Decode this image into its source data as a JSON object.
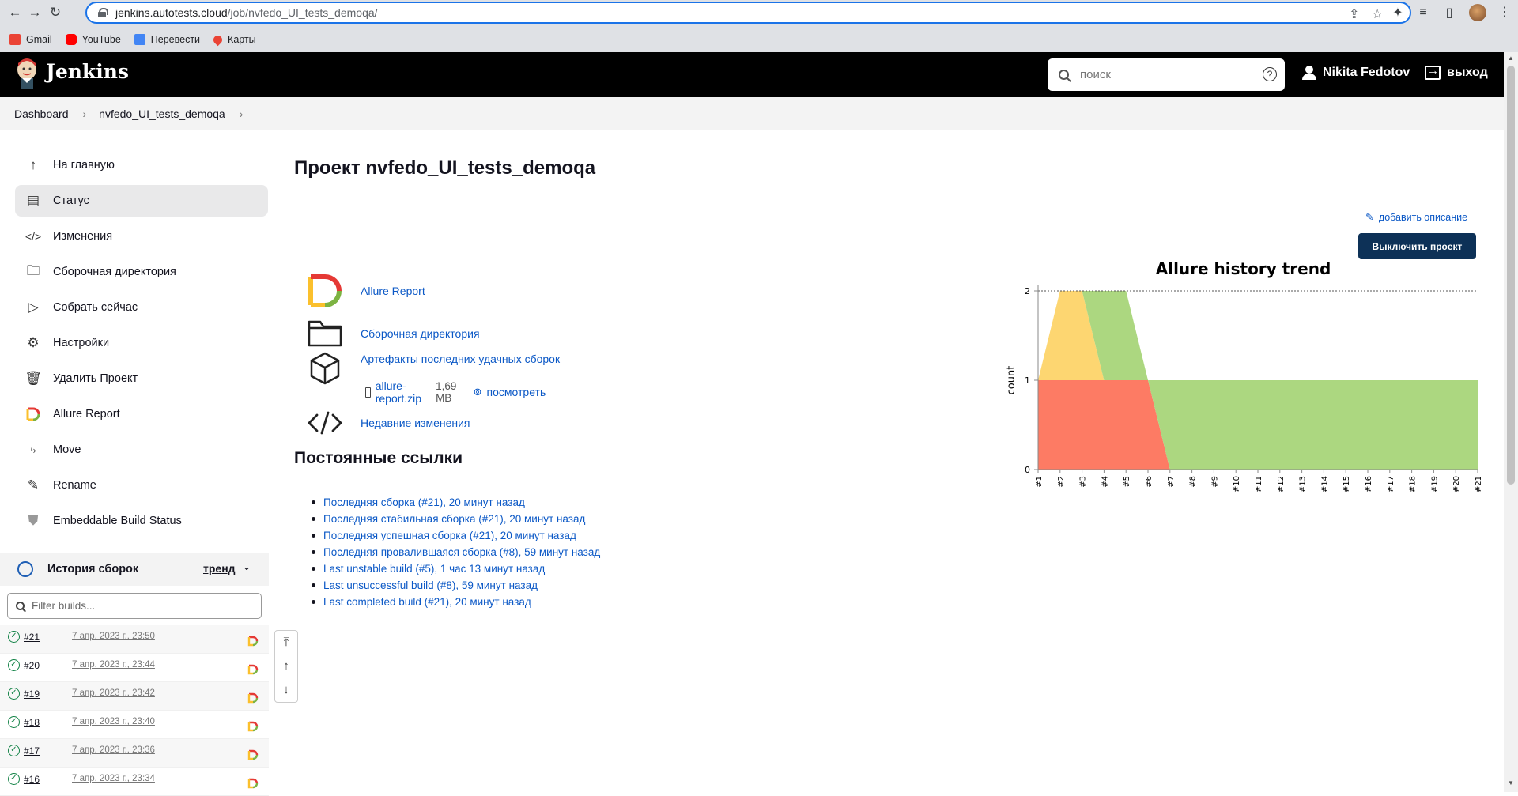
{
  "browser": {
    "url_host": "jenkins.autotests.cloud",
    "url_path": "/job/nvfedo_UI_tests_demoqa/",
    "bookmarks": [
      {
        "label": "Gmail",
        "color": "#ea4335"
      },
      {
        "label": "YouTube",
        "color": "#ff0000"
      },
      {
        "label": "Перевести",
        "color": "#4285f4"
      },
      {
        "label": "Карты",
        "color": "#ea4335"
      }
    ]
  },
  "header": {
    "title": "Jenkins",
    "search_placeholder": "поиск",
    "help": "?",
    "user": "Nikita Fedotov",
    "logout": "выход"
  },
  "breadcrumb": {
    "items": [
      "Dashboard",
      "nvfedo_UI_tests_demoqa"
    ]
  },
  "sidebar": {
    "items": [
      {
        "label": "На главную",
        "icon": "arrow-up-icon"
      },
      {
        "label": "Статус",
        "icon": "status-icon",
        "active": true
      },
      {
        "label": "Изменения",
        "icon": "code-icon"
      },
      {
        "label": "Сборочная директория",
        "icon": "folder-icon"
      },
      {
        "label": "Собрать сейчас",
        "icon": "play-icon"
      },
      {
        "label": "Настройки",
        "icon": "gear-icon"
      },
      {
        "label": "Удалить Проект",
        "icon": "trash-icon"
      },
      {
        "label": "Allure Report",
        "icon": "allure-icon"
      },
      {
        "label": "Move",
        "icon": "move-icon"
      },
      {
        "label": "Rename",
        "icon": "pencil-icon"
      },
      {
        "label": "Embeddable Build Status",
        "icon": "shield-icon"
      }
    ]
  },
  "history": {
    "title": "История сборок",
    "trend": "тренд",
    "filter_placeholder": "Filter builds...",
    "builds": [
      {
        "num": "#21",
        "date": "7 апр. 2023 г., 23:50"
      },
      {
        "num": "#20",
        "date": "7 апр. 2023 г., 23:44"
      },
      {
        "num": "#19",
        "date": "7 апр. 2023 г., 23:42"
      },
      {
        "num": "#18",
        "date": "7 апр. 2023 г., 23:40"
      },
      {
        "num": "#17",
        "date": "7 апр. 2023 г., 23:36"
      },
      {
        "num": "#16",
        "date": "7 апр. 2023 г., 23:34"
      }
    ]
  },
  "main": {
    "title": "Проект nvfedo_UI_tests_demoqa",
    "add_description": "добавить описание",
    "disable_button": "Выключить проект",
    "links": {
      "allure": "Allure Report",
      "workspace": "Сборочная директория",
      "artifacts": "Артефакты последних удачных сборок",
      "artifact_file": "allure-report.zip",
      "artifact_size": "1,69 MB",
      "artifact_view": "посмотреть",
      "changes": "Недавние изменения"
    },
    "permalinks_title": "Постоянные ссылки",
    "permalinks": [
      "Последняя сборка (#21), 20 минут назад",
      "Последняя стабильная сборка (#21), 20 минут назад",
      "Последняя успешная сборка (#21), 20 минут назад",
      "Последняя провалившаяся сборка (#8), 59 минут назад",
      "Last unstable build (#5), 1 час 13 минут назад",
      "Last unsuccessful build (#8), 59 минут назад",
      "Last completed build (#21), 20 минут назад"
    ]
  },
  "chart_data": {
    "type": "area",
    "title": "Allure history trend",
    "ylabel": "count",
    "xlabel": "",
    "ylim": [
      0,
      2
    ],
    "yticks": [
      "0",
      "1",
      "2"
    ],
    "categories": [
      "#1",
      "#2",
      "#3",
      "#4",
      "#5",
      "#6",
      "#7",
      "#8",
      "#9",
      "#10",
      "#11",
      "#12",
      "#13",
      "#14",
      "#15",
      "#16",
      "#17",
      "#18",
      "#19",
      "#20",
      "#21"
    ],
    "series": [
      {
        "color": "#fd7b64",
        "values": [
          1,
          1,
          1,
          1,
          1,
          1,
          0,
          0,
          0,
          0,
          0,
          0,
          0,
          0,
          0,
          0,
          0,
          0,
          0,
          0,
          0
        ]
      },
      {
        "color": "#fdd671",
        "values": [
          0,
          1,
          1,
          0,
          0,
          0,
          0,
          0,
          0,
          0,
          0,
          0,
          0,
          0,
          0,
          0,
          0,
          0,
          0,
          0,
          0
        ]
      },
      {
        "color": "#acd780",
        "values": [
          0,
          0,
          0,
          1,
          1,
          0,
          1,
          1,
          1,
          1,
          1,
          1,
          1,
          1,
          1,
          1,
          1,
          1,
          1,
          1,
          1
        ]
      }
    ],
    "grid": false
  }
}
